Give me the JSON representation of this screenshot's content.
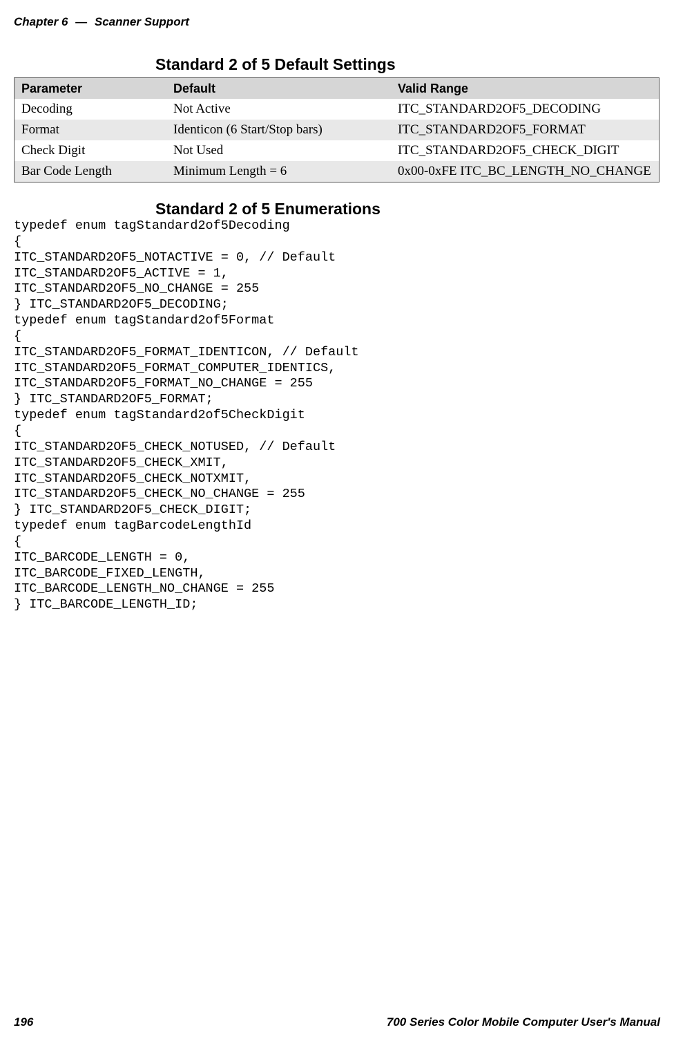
{
  "header": {
    "chapter": "Chapter 6",
    "sep": "—",
    "title": "Scanner Support"
  },
  "headings": {
    "settings": "Standard 2 of 5 Default Settings",
    "enumerations": "Standard 2 of 5 Enumerations"
  },
  "table": {
    "cols": [
      "Parameter",
      "Default",
      "Valid Range"
    ],
    "rows": [
      {
        "alt": false,
        "cells": [
          "Decoding",
          "Not Active",
          "ITC_STANDARD2OF5_DECODING"
        ]
      },
      {
        "alt": true,
        "cells": [
          "Format",
          "Identicon (6 Start/Stop bars)",
          "ITC_STANDARD2OF5_FORMAT"
        ]
      },
      {
        "alt": false,
        "cells": [
          "Check Digit",
          "Not Used",
          "ITC_STANDARD2OF5_CHECK_DIGIT"
        ]
      },
      {
        "alt": true,
        "cells": [
          "Bar Code Length",
          "Minimum Length = 6",
          "0x00-0xFE ITC_BC_LENGTH_NO_CHANGE"
        ]
      }
    ]
  },
  "code": "typedef enum tagStandard2of5Decoding\n{\nITC_STANDARD2OF5_NOTACTIVE = 0, // Default\nITC_STANDARD2OF5_ACTIVE = 1,\nITC_STANDARD2OF5_NO_CHANGE = 255\n} ITC_STANDARD2OF5_DECODING;\ntypedef enum tagStandard2of5Format\n{\nITC_STANDARD2OF5_FORMAT_IDENTICON, // Default\nITC_STANDARD2OF5_FORMAT_COMPUTER_IDENTICS,\nITC_STANDARD2OF5_FORMAT_NO_CHANGE = 255\n} ITC_STANDARD2OF5_FORMAT;\ntypedef enum tagStandard2of5CheckDigit\n{\nITC_STANDARD2OF5_CHECK_NOTUSED, // Default\nITC_STANDARD2OF5_CHECK_XMIT,\nITC_STANDARD2OF5_CHECK_NOTXMIT,\nITC_STANDARD2OF5_CHECK_NO_CHANGE = 255\n} ITC_STANDARD2OF5_CHECK_DIGIT;\ntypedef enum tagBarcodeLengthId\n{\nITC_BARCODE_LENGTH = 0,\nITC_BARCODE_FIXED_LENGTH,\nITC_BARCODE_LENGTH_NO_CHANGE = 255\n} ITC_BARCODE_LENGTH_ID;",
  "footer": {
    "page": "196",
    "title": "700 Series Color Mobile Computer User's Manual"
  }
}
